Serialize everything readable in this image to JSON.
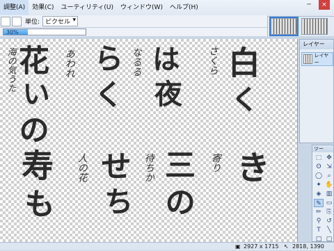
{
  "menubar": {
    "items": [
      "調整(A)",
      "効果(C)",
      "ユーティリティ(U)",
      "ウィンドウ(W)",
      "ヘルプ(H)"
    ]
  },
  "toolbar": {
    "unit_label": "単位:",
    "unit_value": "ピクセル"
  },
  "progress": {
    "text": "30%",
    "fraction": 0.3
  },
  "window_buttons": [
    "─",
    "×"
  ],
  "canvas": {
    "brush_glyphs": [
      "花",
      "い",
      "の",
      "ら",
      "く",
      "は",
      "夜",
      "白",
      "く",
      "三",
      "の",
      "き",
      "せ",
      "ち",
      "寿",
      "も"
    ],
    "thin_lines": [
      "海の気うた",
      "あわれ",
      "なるる",
      "さくら",
      "人の花",
      "待ちか",
      "寄り"
    ]
  },
  "layers_panel": {
    "title": "レイヤー",
    "layer_name": "レイヤー"
  },
  "tools_panel": {
    "title": "ツー",
    "icons": [
      "select-rect-icon",
      "move-icon",
      "lasso-icon",
      "move-selection-icon",
      "ellipse-select-icon",
      "zoom-icon",
      "magic-wand-icon",
      "pan-icon",
      "bucket-icon",
      "gradient-icon",
      "brush-icon",
      "eraser-icon",
      "pencil-icon",
      "clone-icon",
      "color-picker-icon",
      "recolor-icon",
      "text-icon",
      "line-icon",
      "rect-icon",
      "rounded-rect-icon"
    ]
  },
  "statusbar": {
    "image_size": "2927 x 1715",
    "cursor_pos": "2818, 1390"
  }
}
